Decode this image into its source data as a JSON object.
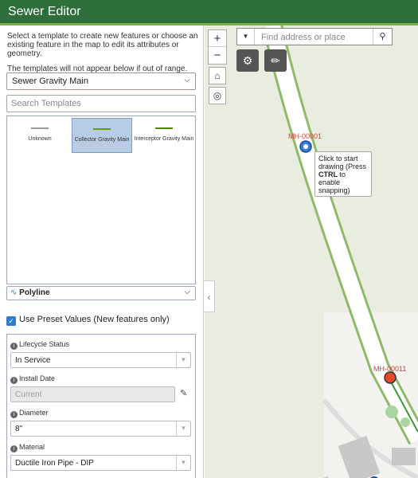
{
  "header": {
    "title": "Sewer Editor"
  },
  "panel": {
    "instruction_1": "Select a template to create new features or choose an existing feature in the map to edit its attributes or geometry.",
    "instruction_2": "The templates will not appear below if out of range.",
    "layer_select": "Sewer Gravity Main",
    "search_placeholder": "Search Templates",
    "templates": [
      {
        "label": "Unknown",
        "color": "#999999"
      },
      {
        "label": "Collector Gravity Main",
        "color": "#57a300"
      },
      {
        "label": "Interceptor Gravity Main",
        "color": "#4a8a00"
      }
    ],
    "geometry": "Polyline",
    "preset_label": "Use Preset Values (New features only)",
    "preset_checked": true,
    "fields": [
      {
        "label": "Lifecycle Status",
        "value": "In Service"
      },
      {
        "label": "Install Date",
        "value": "Current"
      },
      {
        "label": "Diameter",
        "value": "8\""
      },
      {
        "label": "Material",
        "value": "Ductile Iron Pipe - DIP"
      }
    ]
  },
  "map": {
    "search_placeholder": "Find address or place",
    "manholes": [
      "MH-00001",
      "MH-00011"
    ],
    "tooltip_pre": "Click to start drawing (Press ",
    "tooltip_key": "CTRL",
    "tooltip_post": " to enable snapping)"
  },
  "icons": [
    "plus-icon",
    "minus-icon",
    "home-icon",
    "locate-icon",
    "settings-icon",
    "measure-icon",
    "search-icon",
    "chevron-down-icon",
    "chevron-left-icon",
    "info-icon",
    "pencil-icon",
    "polyline-icon",
    "check-icon"
  ]
}
